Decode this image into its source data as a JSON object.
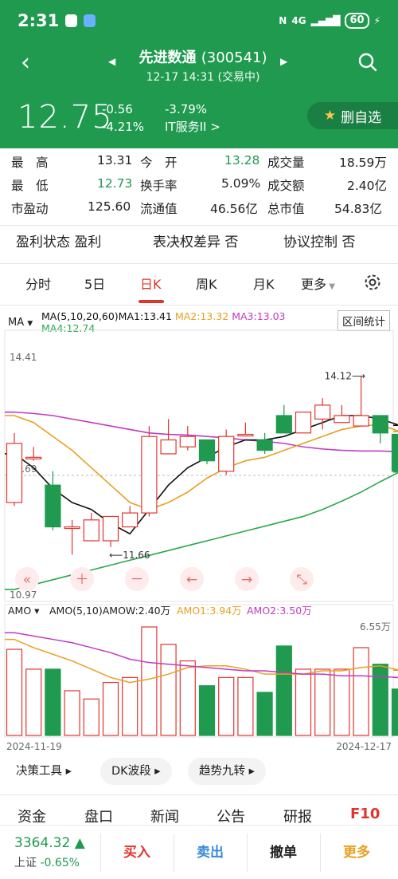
{
  "status_bar": {
    "time": "2:31",
    "signal": "4G",
    "battery": "60"
  },
  "header": {
    "stock_name": "先进数通",
    "stock_code": "(300541)",
    "subtitle": "12-17 14:31 (交易中)",
    "price": "12.75",
    "change": "-0.56",
    "change_pct_neg": "-4.21%",
    "pct": "-3.79%",
    "sector": "IT服务II >",
    "fav_label": "删自选"
  },
  "stats": [
    [
      {
        "l": "最　高"
      },
      {
        "v": "13.31"
      },
      {
        "l": "今　开"
      },
      {
        "v": "13.28",
        "c": "green"
      },
      {
        "l": "成交量"
      },
      {
        "v": "18.59万"
      }
    ],
    [
      {
        "l": "最　低"
      },
      {
        "v": "12.73",
        "c": "green"
      },
      {
        "l": "换手率"
      },
      {
        "v": "5.09%"
      },
      {
        "l": "成交额"
      },
      {
        "v": "2.40亿"
      }
    ],
    [
      {
        "l": "市盈动"
      },
      {
        "v": "125.60"
      },
      {
        "l": "流通值"
      },
      {
        "v": "46.56亿"
      },
      {
        "l": "总市值"
      },
      {
        "v": "54.83亿"
      }
    ]
  ],
  "flags": {
    "profit": "盈利状态 盈利",
    "voting": "表决权差异 否",
    "control": "协议控制 否"
  },
  "tabs": {
    "t1": "分时",
    "t2": "5日",
    "t3": "日K",
    "t4": "周K",
    "t5": "月K",
    "t6": "更多"
  },
  "quota": {
    "ma_btn": "MA",
    "line1_a": "MA(5,10,20,60)MA1:13.41 ",
    "line1_b": "MA2:13.32 ",
    "line1_c": "MA3:13.03",
    "line2": "MA4:12.74",
    "interval": "区间统计",
    "amo_btn": "AMO",
    "amo_a": "AMO(5,10)AMOW:2.40万 ",
    "amo_b": "AMO1:3.94万 ",
    "amo_c": "AMO2:3.50万"
  },
  "colors": {
    "up": "#e0352f",
    "down": "#1f9a4f",
    "ma1": "#111111",
    "ma2": "#e8a020",
    "ma3": "#c23ac2",
    "ma4": "#2aa84a"
  },
  "chart_data": {
    "type": "candlestick",
    "y_top_label": "14.41",
    "y_bottom_label": "10.97",
    "y_mid_label": "12.69",
    "max_annot": "14.12",
    "min_annot": "11.66",
    "vol_top_label": "6.55万",
    "date_start": "2024-11-19",
    "date_end": "2024-12-17",
    "candles": [
      {
        "o": 12.3,
        "c": 13.15,
        "h": 13.3,
        "l": 12.25
      },
      {
        "o": 12.95,
        "c": 12.95,
        "h": 13.1,
        "l": 12.9
      },
      {
        "o": 12.55,
        "c": 11.95,
        "h": 12.75,
        "l": 11.9
      },
      {
        "o": 11.95,
        "c": 11.95,
        "h": 12.05,
        "l": 11.55
      },
      {
        "o": 11.75,
        "c": 12.05,
        "h": 12.15,
        "l": 11.75
      },
      {
        "o": 11.75,
        "c": 12.1,
        "h": 12.1,
        "l": 11.66
      },
      {
        "o": 11.95,
        "c": 12.15,
        "h": 12.25,
        "l": 11.95
      },
      {
        "o": 12.15,
        "c": 13.25,
        "h": 13.4,
        "l": 12.1
      },
      {
        "o": 13.0,
        "c": 13.2,
        "h": 13.5,
        "l": 13.0
      },
      {
        "o": 13.1,
        "c": 13.25,
        "h": 13.4,
        "l": 13.05
      },
      {
        "o": 13.2,
        "c": 12.9,
        "h": 13.2,
        "l": 12.85
      },
      {
        "o": 12.75,
        "c": 13.25,
        "h": 13.35,
        "l": 12.7
      },
      {
        "o": 13.28,
        "c": 13.28,
        "h": 13.45,
        "l": 13.25
      },
      {
        "o": 13.2,
        "c": 13.05,
        "h": 13.3,
        "l": 13.0
      },
      {
        "o": 13.55,
        "c": 13.3,
        "h": 13.7,
        "l": 13.3
      },
      {
        "o": 13.3,
        "c": 13.6,
        "h": 13.6,
        "l": 13.3
      },
      {
        "o": 13.5,
        "c": 13.7,
        "h": 13.8,
        "l": 13.35
      },
      {
        "o": 13.45,
        "c": 13.55,
        "h": 13.7,
        "l": 13.45
      },
      {
        "o": 13.4,
        "c": 13.55,
        "h": 14.12,
        "l": 13.45
      },
      {
        "o": 13.55,
        "c": 13.3,
        "h": 13.55,
        "l": 13.15
      },
      {
        "o": 13.28,
        "c": 12.75,
        "h": 13.31,
        "l": 12.73
      }
    ],
    "ma1": [
      13.0,
      12.8,
      12.5,
      12.3,
      12.2,
      12.0,
      11.85,
      12.2,
      12.55,
      12.8,
      12.95,
      13.1,
      13.2,
      13.2,
      13.25,
      13.35,
      13.45,
      13.55,
      13.55,
      13.5,
      13.41
    ],
    "ma2": [
      13.55,
      13.45,
      13.25,
      13.05,
      12.8,
      12.55,
      12.3,
      12.2,
      12.3,
      12.45,
      12.65,
      12.8,
      12.9,
      12.95,
      13.05,
      13.15,
      13.25,
      13.35,
      13.4,
      13.42,
      13.32
    ],
    "ma3": [
      13.6,
      13.58,
      13.55,
      13.5,
      13.45,
      13.4,
      13.35,
      13.3,
      13.28,
      13.27,
      13.25,
      13.23,
      13.2,
      13.18,
      13.15,
      13.1,
      13.07,
      13.05,
      13.04,
      13.04,
      13.03
    ],
    "ma4": [
      11.05,
      11.12,
      11.19,
      11.26,
      11.33,
      11.4,
      11.47,
      11.54,
      11.61,
      11.68,
      11.75,
      11.82,
      11.89,
      11.96,
      12.03,
      12.1,
      12.2,
      12.32,
      12.45,
      12.6,
      12.74
    ],
    "volume": [
      5.2,
      4.0,
      4.0,
      2.7,
      2.2,
      3.2,
      3.5,
      6.55,
      5.5,
      4.5,
      3.0,
      3.5,
      3.5,
      2.6,
      5.4,
      4.0,
      4.0,
      4.0,
      5.3,
      4.3,
      2.8
    ],
    "amo1": [
      5.8,
      5.3,
      4.9,
      4.5,
      4.0,
      3.5,
      3.2,
      3.4,
      3.7,
      4.1,
      4.2,
      4.2,
      4.0,
      3.7,
      3.7,
      3.7,
      3.9,
      3.9,
      4.1,
      4.2,
      3.94
    ],
    "amo2": [
      6.2,
      6.0,
      5.8,
      5.6,
      5.3,
      5.0,
      4.6,
      4.4,
      4.3,
      4.2,
      4.1,
      4.0,
      3.9,
      3.9,
      3.8,
      3.7,
      3.7,
      3.6,
      3.6,
      3.55,
      3.5
    ]
  },
  "tools": {
    "t1": "决策工具 ▸",
    "t2": "DK波段 ▸",
    "t3": "趋势九转 ▸"
  },
  "bottomnav": {
    "n1": "资金",
    "n2": "盘口",
    "n3": "新闻",
    "n4": "公告",
    "n5": "研报",
    "n6": "F10"
  },
  "footer": {
    "index_value": "3364.32 ▲",
    "index_name": "上证",
    "index_change": "-0.65%",
    "buy": "买入",
    "sell": "卖出",
    "cancel": "撤单",
    "more": "更多"
  }
}
